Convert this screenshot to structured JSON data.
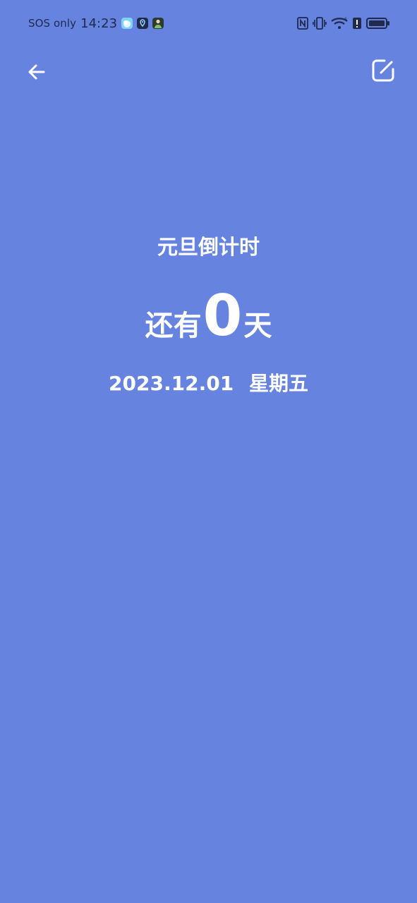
{
  "status_bar": {
    "network_text": "SOS only",
    "time": "14:23",
    "icons": [
      "weather-icon",
      "location-pin-icon",
      "avatar-app-icon"
    ],
    "right_icons": [
      "nfc-icon",
      "vibrate-icon",
      "wifi-icon",
      "alert-icon",
      "battery-icon"
    ],
    "text_color": "#1f2a4d"
  },
  "header": {
    "back_icon": "arrow-left-icon",
    "edit_icon": "edit-square-icon"
  },
  "countdown": {
    "title": "元旦倒计时",
    "prefix": "还有",
    "number": "0",
    "unit": "天",
    "date": "2023.12.01",
    "weekday": "星期五"
  },
  "theme": {
    "background": "#6683e0",
    "foreground": "#ffffff"
  }
}
